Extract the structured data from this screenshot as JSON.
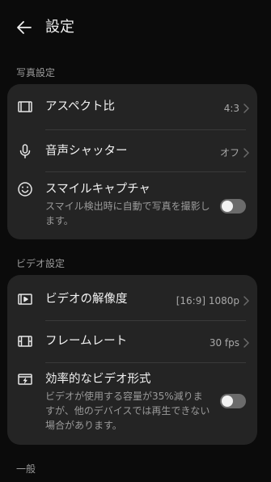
{
  "header": {
    "title": "設定",
    "back_icon": "arrow-left-icon"
  },
  "sections": {
    "photo": {
      "label": "写真設定",
      "items": [
        {
          "title": "アスペクト比",
          "value": "4:3",
          "icon": "aspect-ratio-icon"
        },
        {
          "title": "音声シャッター",
          "value": "オフ",
          "icon": "microphone-icon"
        },
        {
          "title": "スマイルキャプチャ",
          "description": "スマイル検出時に自動で写真を撮影します。",
          "icon": "smile-icon",
          "toggle_on": false
        }
      ]
    },
    "video": {
      "label": "ビデオ設定",
      "items": [
        {
          "title": "ビデオの解像度",
          "value": "[16:9] 1080p",
          "icon": "video-resolution-icon"
        },
        {
          "title": "フレームレート",
          "value": "30 fps",
          "icon": "film-frame-icon"
        },
        {
          "title": "効率的なビデオ形式",
          "description": "ビデオが使用する容量が35%減りますが、他のデバイスでは再生できない場合があります。",
          "icon": "video-format-icon",
          "toggle_on": false
        }
      ]
    },
    "general": {
      "label": "一般"
    }
  },
  "colors": {
    "background": "#0b0b0b",
    "card": "#242424",
    "toggle_off": "#6b6b6b"
  }
}
